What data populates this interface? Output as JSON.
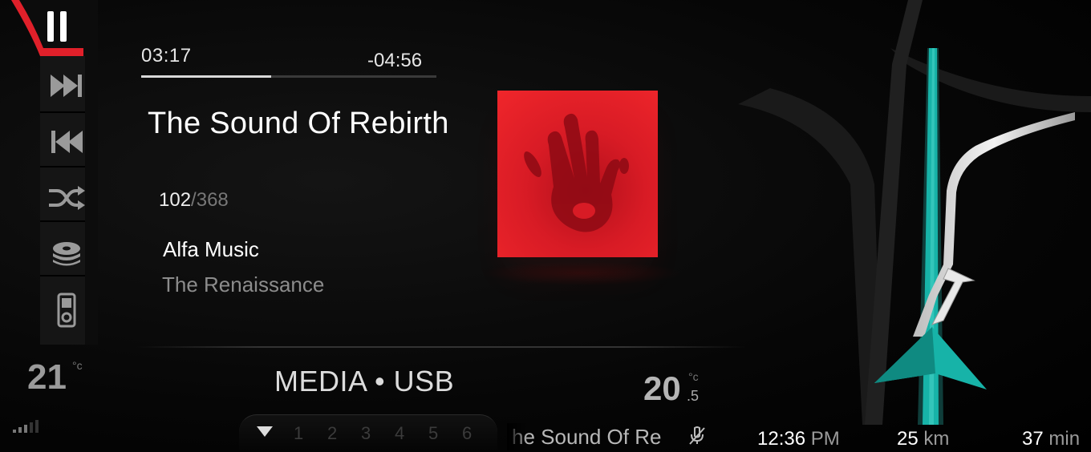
{
  "player": {
    "time_elapsed": "03:17",
    "time_remaining": "-04:56",
    "progress_fraction": 0.44,
    "track_title": "The Sound Of Rebirth",
    "track_index": "102",
    "track_total": "/368",
    "artist": "Alfa Music",
    "album": "The Renaissance"
  },
  "controls": {
    "icons": [
      "pause-icon",
      "next-track-icon",
      "previous-track-icon",
      "shuffle-icon",
      "disc-stack-icon",
      "ipod-icon"
    ]
  },
  "status": {
    "temp_left": "21",
    "temp_left_unit": "°c",
    "source_label": "MEDIA • USB",
    "temp_right": "20",
    "temp_right_unit": "°c",
    "temp_right_decimal": ".5"
  },
  "presets": {
    "items": [
      "1",
      "2",
      "3",
      "4",
      "5",
      "6"
    ]
  },
  "footer": {
    "ticker_text": "he Sound Of Re",
    "clock_time": "12:36",
    "clock_ampm": "PM",
    "distance_value": "25",
    "distance_unit": "km",
    "eta_value": "37",
    "eta_unit": "min"
  },
  "colors": {
    "accent_red": "#e0202a",
    "route_teal": "#17b3a8",
    "album_red": "#d81b25"
  }
}
